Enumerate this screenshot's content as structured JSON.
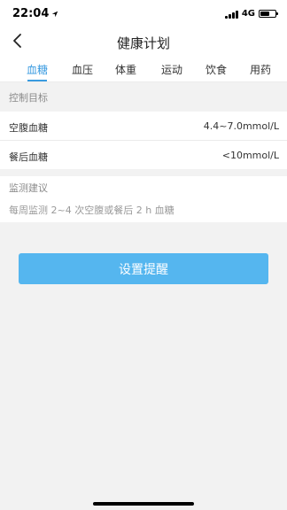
{
  "status_bar": {
    "time": "22:04",
    "network": "4G",
    "battery_level": 0.6
  },
  "nav": {
    "title": "健康计划"
  },
  "tabs": [
    {
      "label": "血糖",
      "active": true
    },
    {
      "label": "血压",
      "active": false
    },
    {
      "label": "体重",
      "active": false
    },
    {
      "label": "运动",
      "active": false
    },
    {
      "label": "饮食",
      "active": false
    },
    {
      "label": "用药",
      "active": false
    }
  ],
  "control_targets": {
    "header": "控制目标",
    "rows": [
      {
        "label": "空腹血糖",
        "value": "4.4~7.0mmol/L"
      },
      {
        "label": "餐后血糖",
        "value": "<10mmol/L"
      }
    ]
  },
  "monitoring_advice": {
    "header": "监测建议",
    "text": "每周监测 2~4 次空腹或餐后 2 h 血糖"
  },
  "reminder_button": {
    "label": "设置提醒"
  },
  "colors": {
    "accent": "#3a9be0",
    "button": "#55b6ef",
    "background": "#f2f2f2"
  },
  "icons": {
    "back": "chevron-left-icon",
    "location": "location-arrow-icon",
    "signal": "signal-bars-icon",
    "battery": "battery-icon"
  }
}
